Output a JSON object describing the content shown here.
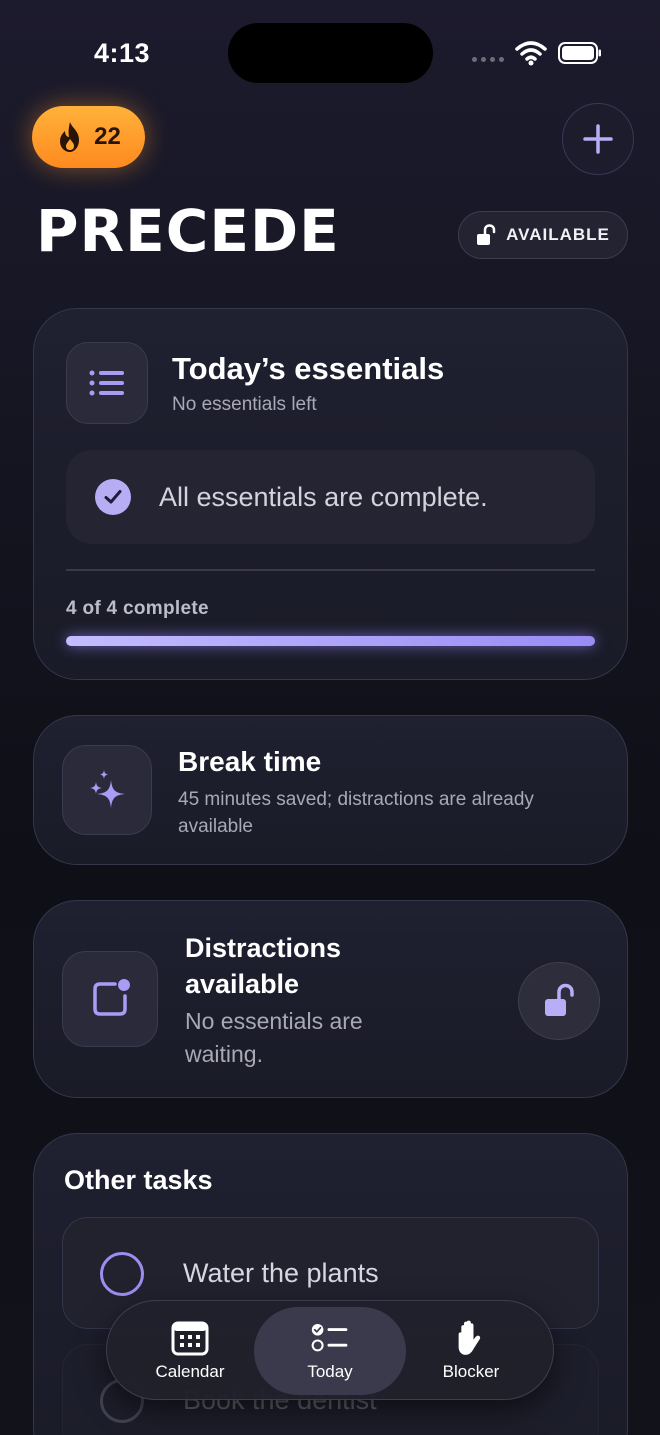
{
  "status_bar": {
    "time": "4:13"
  },
  "header": {
    "streak_count": "22",
    "app_title": "PRECEDE",
    "availability_label": "AVAILABLE"
  },
  "essentials": {
    "title": "Today’s essentials",
    "subtitle": "No essentials left",
    "complete_message": "All essentials are complete.",
    "progress_label": "4 of 4 complete",
    "progress_fraction": 1.0
  },
  "break_card": {
    "title": "Break time",
    "description": "45 minutes saved; distractions are already available"
  },
  "distractions_card": {
    "title": "Distractions available",
    "description": "No essentials are waiting."
  },
  "other_tasks": {
    "title": "Other tasks",
    "items": [
      {
        "label": "Water the plants"
      },
      {
        "label": "Book the dentist"
      }
    ]
  },
  "tabbar": {
    "tabs": [
      {
        "label": "Calendar",
        "icon": "calendar-icon"
      },
      {
        "label": "Today",
        "icon": "checklist-icon",
        "selected": true
      },
      {
        "label": "Blocker",
        "icon": "hand-icon"
      }
    ]
  },
  "colors": {
    "accent": "#9b8ef0",
    "streak": "#ff9d2a",
    "background": "#141420"
  }
}
